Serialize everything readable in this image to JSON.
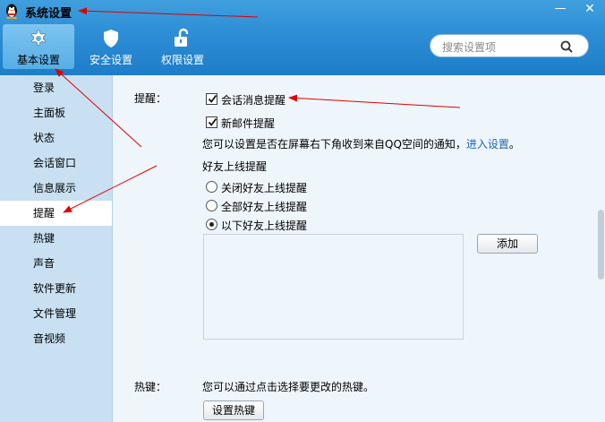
{
  "window": {
    "title": "系统设置",
    "minimize_glyph": "—",
    "close_glyph": "✕"
  },
  "toolbar": {
    "basic": "基本设置",
    "security": "安全设置",
    "permission": "权限设置",
    "active": "basic"
  },
  "search": {
    "placeholder": "搜索设置项"
  },
  "sidebar": {
    "items": [
      "登录",
      "主面板",
      "状态",
      "会话窗口",
      "信息展示",
      "提醒",
      "热键",
      "声音",
      "软件更新",
      "文件管理",
      "音视频"
    ],
    "active_index": 5
  },
  "reminder": {
    "section_label": "提醒：",
    "session_msg": {
      "label": "会话消息提醒",
      "checked": true
    },
    "new_mail": {
      "label": "新邮件提醒",
      "checked": true
    },
    "qzone_text": "您可以设置是否在屏幕右下角收到来自QQ空间的通知，",
    "qzone_link": "进入设置",
    "qzone_period": "。",
    "friend_online_title": "好友上线提醒",
    "radio_off": "关闭好友上线提醒",
    "radio_all": "全部好友上线提醒",
    "radio_some": "以下好友上线提醒",
    "selected_radio": "some",
    "add_button": "添加"
  },
  "hotkey": {
    "section_label": "热键：",
    "description": "您可以通过点击选择要更改的热键。",
    "set_button": "设置热键"
  },
  "colors": {
    "header": "#2a8ad3",
    "sidebar": "#c8e0f1",
    "content": "#eef5fb",
    "link": "#1a68b8",
    "annotation": "#e00000"
  }
}
